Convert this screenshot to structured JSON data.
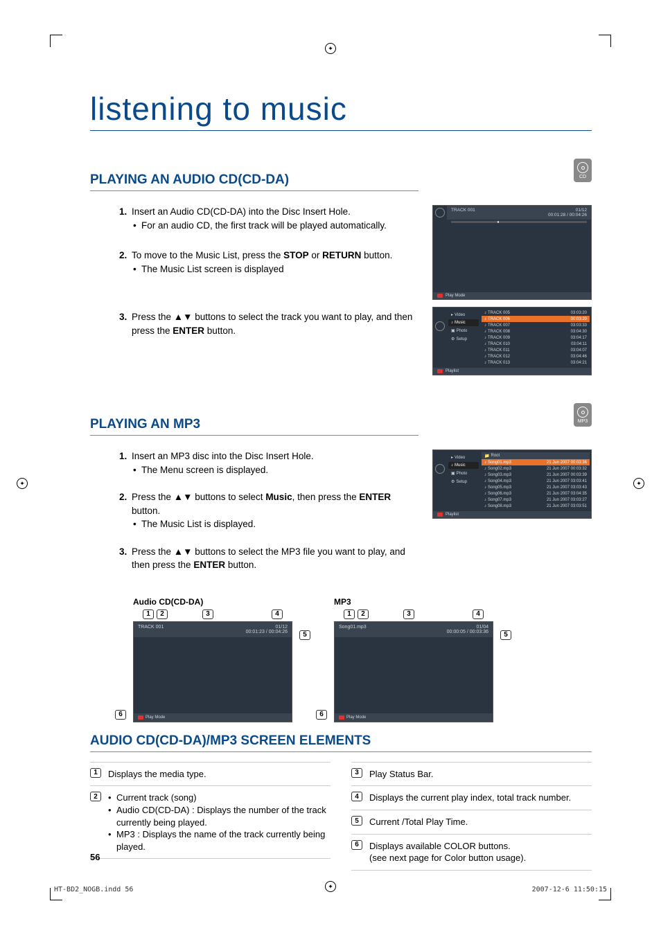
{
  "title": "listening to music",
  "disc_badge": {
    "cd": "CD",
    "mp3": "MP3"
  },
  "sec1": {
    "heading": "PLAYING AN AUDIO CD(CD-DA)",
    "step1": "Insert an Audio CD(CD-DA) into the Disc Insert Hole.",
    "step1_b": "For an audio CD, the first track will be played automatically.",
    "step2a": "To move to the Music List, press the ",
    "step2_stop": "STOP",
    "step2_or": " or ",
    "step2_return": "RETURN",
    "step2b": " button.",
    "step2_c": "The Music List screen is displayed",
    "step3a": "Press the ▲▼ buttons to select the track you want to play, and then press the ",
    "step3_enter": "ENTER",
    "step3b": " button."
  },
  "ui_player": {
    "track": "TRACK 001",
    "index": "01/12",
    "time": "00:01:28 / 00:04:26",
    "footer": "Play Mode"
  },
  "ui_list": {
    "tabs": [
      "Video",
      "Music",
      "Photo",
      "Setup"
    ],
    "rows": [
      {
        "n": "TRACK 005",
        "t": "03:03:20"
      },
      {
        "n": "TRACK 006",
        "t": "00:03:20"
      },
      {
        "n": "TRACK 007",
        "t": "03:03:33"
      },
      {
        "n": "TRACK 008",
        "t": "03:04:30"
      },
      {
        "n": "TRACK 009",
        "t": "03:04:17"
      },
      {
        "n": "TRACK 010",
        "t": "03:04:11"
      },
      {
        "n": "TRACK 011",
        "t": "03:04:07"
      },
      {
        "n": "TRACK 012",
        "t": "03:04:46"
      },
      {
        "n": "TRACK 013",
        "t": "03:04:21"
      }
    ],
    "footer": "Playlist"
  },
  "sec2": {
    "heading": "PLAYING AN MP3",
    "step1": "Insert an MP3 disc into the Disc Insert Hole.",
    "step1_b": "The Menu screen is displayed.",
    "step2a": "Press the ▲▼ buttons to select ",
    "step2_music": "Music",
    "step2b": ", then press the ",
    "step2_enter": "ENTER",
    "step2c": " button.",
    "step2_d": "The Music List is displayed.",
    "step3a": "Press the ▲▼ buttons to select the MP3 file you want to play, and then press the ",
    "step3_enter": "ENTER",
    "step3b": " button."
  },
  "ui_mp3": {
    "root": "Root",
    "rows": [
      {
        "n": "Song01.mp3",
        "t": "21 Jun 2007  00:03:36"
      },
      {
        "n": "Song02.mp3",
        "t": "21 Jun 2007  00:03:32"
      },
      {
        "n": "Song03.mp3",
        "t": "21 Jun 2007  00:03:39"
      },
      {
        "n": "Song04.mp3",
        "t": "21 Jun 2007  03:03:41"
      },
      {
        "n": "Song05.mp3",
        "t": "21 Jun 2007  03:03:43"
      },
      {
        "n": "Song06.mp3",
        "t": "21 Jun 2007  03:04:35"
      },
      {
        "n": "Song07.mp3",
        "t": "21 Jun 2007  03:03:27"
      },
      {
        "n": "Song08.mp3",
        "t": "21 Jun 2007  03:03:51"
      }
    ],
    "footer": "Playlist"
  },
  "anno": {
    "cd_label": "Audio CD(CD-DA)",
    "mp3_label": "MP3",
    "cd_track": "TRACK 001",
    "cd_idx": "01/12",
    "cd_time": "00:01:23 / 00:04:26",
    "cd_footer": "Play Mode",
    "mp3_track": "Song01.mp3",
    "mp3_idx": "01/04",
    "mp3_time": "00:00:05 / 00:03:36",
    "mp3_footer": "Play Mode"
  },
  "sec3": {
    "heading": "AUDIO CD(CD-DA)/MP3 SCREEN ELEMENTS",
    "e1": "Displays the media type.",
    "e2a": "Current track (song)",
    "e2b": "Audio CD(CD-DA) : Displays the number of the track currently being played.",
    "e2c": "MP3 : Displays the name of the track currently being played.",
    "e3": "Play Status Bar.",
    "e4": "Displays the current play index, total track number.",
    "e5": "Current /Total Play Time.",
    "e6a": "Displays available COLOR buttons.",
    "e6b": "(see next page for Color button usage)."
  },
  "pagenum": "56",
  "meta_file": "HT-BD2_NOGB.indd   56",
  "meta_date": "2007-12-6   11:50:15"
}
